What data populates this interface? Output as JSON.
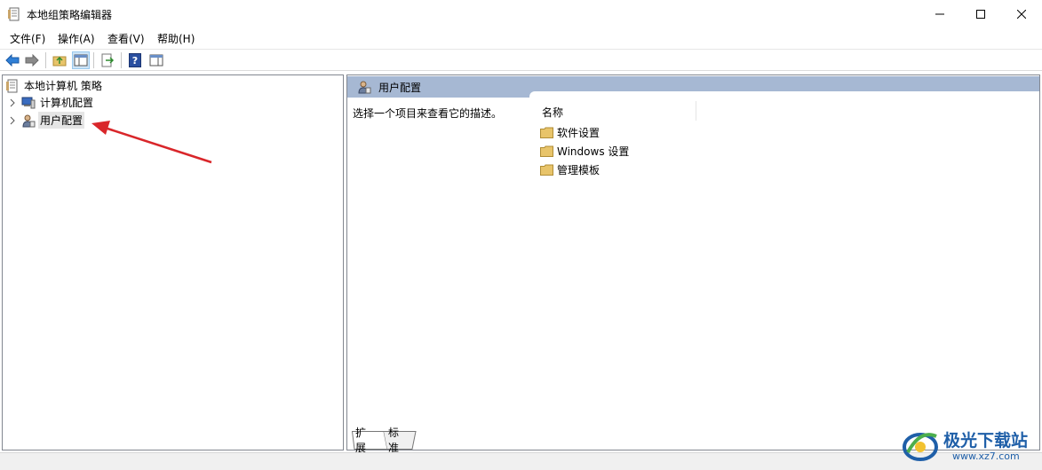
{
  "window": {
    "title": "本地组策略编辑器"
  },
  "menu": {
    "items": [
      {
        "label": "文件(F)"
      },
      {
        "label": "操作(A)"
      },
      {
        "label": "查看(V)"
      },
      {
        "label": "帮助(H)"
      }
    ]
  },
  "toolbar": {
    "buttons": [
      "back-icon",
      "forward-icon",
      "up-folder-icon",
      "show-hide-tree-icon",
      "export-list-icon",
      "help-icon",
      "properties-icon"
    ]
  },
  "tree": {
    "root_label": "本地计算机 策略",
    "items": [
      {
        "label": "计算机配置",
        "icon": "computer-icon"
      },
      {
        "label": "用户配置",
        "icon": "user-icon",
        "selected": true
      }
    ]
  },
  "details": {
    "header_title": "用户配置",
    "description": "选择一个项目来查看它的描述。",
    "column_name": "名称",
    "items": [
      {
        "label": "软件设置"
      },
      {
        "label": "Windows 设置"
      },
      {
        "label": "管理模板"
      }
    ],
    "tabs": [
      {
        "label": "扩展"
      },
      {
        "label": "标准"
      }
    ]
  },
  "watermark": {
    "brand": "极光下载站",
    "url": "www.xz7.com"
  },
  "colors": {
    "header_bg": "#a6b8d3",
    "arrow": "#d9262a",
    "folder": "#e8c46a"
  }
}
